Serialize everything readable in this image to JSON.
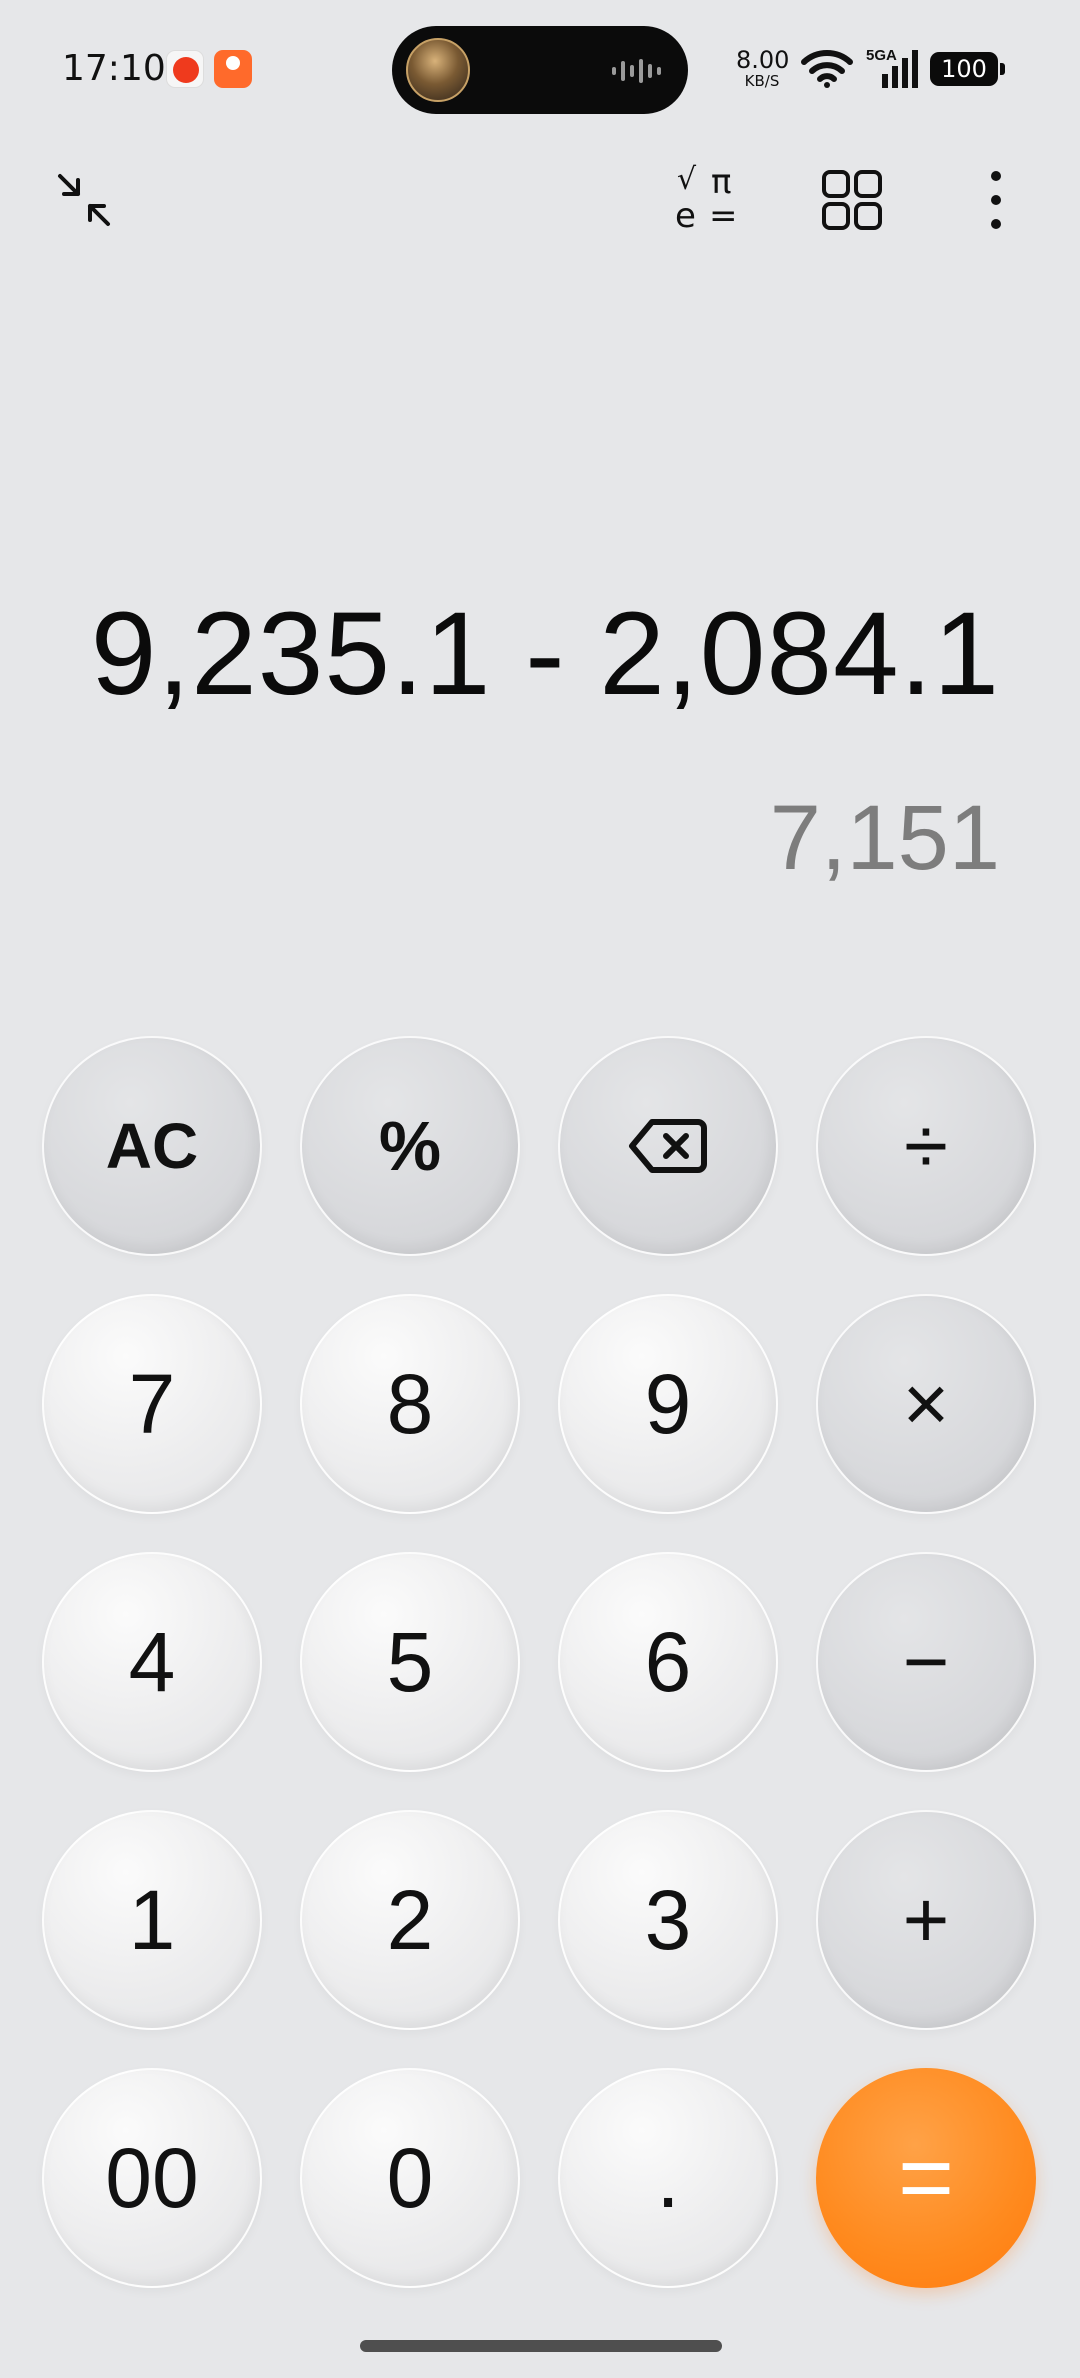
{
  "status_bar": {
    "time": "17:10",
    "network_speed_value": "8.00",
    "network_speed_unit": "KB/S",
    "signal_label": "5GA",
    "battery": "100"
  },
  "toolbar": {
    "scientific_icon_symbols": [
      "√",
      "π",
      "e",
      "="
    ],
    "icons": [
      "collapse-icon",
      "scientific-mode-icon",
      "grid-icon",
      "more-icon"
    ]
  },
  "display": {
    "expression": "9,235.1 - 2,084.1",
    "result": "7,151"
  },
  "keypad": {
    "rows": [
      [
        "AC",
        "%",
        "backspace",
        "÷"
      ],
      [
        "7",
        "8",
        "9",
        "×"
      ],
      [
        "4",
        "5",
        "6",
        "−"
      ],
      [
        "1",
        "2",
        "3",
        "+"
      ],
      [
        "00",
        "0",
        ".",
        "="
      ]
    ],
    "ac": "AC",
    "percent": "%",
    "divide": "÷",
    "seven": "7",
    "eight": "8",
    "nine": "9",
    "multiply": "×",
    "four": "4",
    "five": "5",
    "six": "6",
    "minus": "−",
    "one": "1",
    "two": "2",
    "three": "3",
    "plus": "+",
    "double_zero": "00",
    "zero": "0",
    "decimal": ".",
    "equals": "="
  },
  "colors": {
    "background": "#e6e7e9",
    "accent": "#ff8a1e",
    "result_text": "#7d7d7d"
  }
}
